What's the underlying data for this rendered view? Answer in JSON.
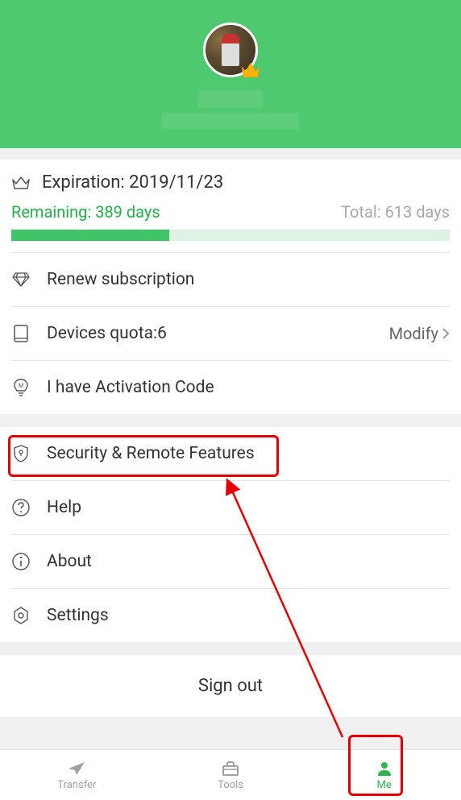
{
  "header": {
    "username_obscured": "",
    "email_obscured": ""
  },
  "subscription": {
    "expiration_label": "Expiration: 2019/11/23",
    "remaining_label": "Remaining: 389 days",
    "total_label": "Total: 613 days",
    "progress_percent": 36
  },
  "menu": {
    "renew": "Renew subscription",
    "devices_quota": "Devices quota:6",
    "modify": "Modify",
    "activation": "I have Activation Code",
    "security": "Security & Remote Features",
    "help": "Help",
    "about": "About",
    "settings": "Settings"
  },
  "signout": {
    "label": "Sign out"
  },
  "nav": {
    "transfer": "Transfer",
    "tools": "Tools",
    "me": "Me"
  }
}
